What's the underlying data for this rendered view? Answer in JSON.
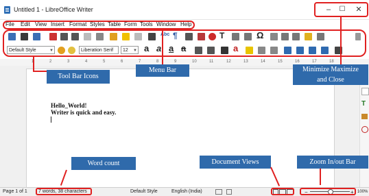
{
  "window": {
    "title": "Untitled 1 - LibreOffice Writer",
    "minimize_glyph": "–",
    "maximize_glyph": "☐",
    "close_glyph": "✕"
  },
  "menu": {
    "items": [
      "File",
      "Edit",
      "View",
      "Insert",
      "Format",
      "Styles",
      "Table",
      "Form",
      "Tools",
      "Window",
      "Help"
    ]
  },
  "toolbar": {
    "paragraph_style": "Default Style",
    "font_name": "Liberation Serif",
    "font_size": "12",
    "italic_glyph": "a",
    "spell_glyph": "Abc",
    "pilcrow_glyph": "¶",
    "omega_glyph": "Ω",
    "text_glyph": "T"
  },
  "ruler": {
    "ticks": [
      "1",
      "2",
      "3",
      "4",
      "5",
      "6",
      "7",
      "8",
      "9",
      "10",
      "11",
      "12",
      "13",
      "14",
      "15",
      "16",
      "17",
      "18"
    ]
  },
  "document": {
    "line1": "Hello_World!",
    "line2": "Writer is quick and easy."
  },
  "annotations": {
    "toolbar_icons": "Tool Bar Icons",
    "menu_bar": "Menu Bar",
    "window_controls": "Minimize Maximize\nand Close",
    "word_count": "Word count",
    "document_views": "Document Views",
    "zoom": "Zoom In/out Bar"
  },
  "status": {
    "page": "Page 1 of 1",
    "words": "7 words, 38 characters",
    "style": "Default Style",
    "language": "English (India)",
    "zoom_minus": "−",
    "zoom_plus": "+",
    "zoom_level": "100%"
  },
  "colors": {
    "callout_blue": "#2f6aab",
    "highlight_red": "#e02020"
  }
}
